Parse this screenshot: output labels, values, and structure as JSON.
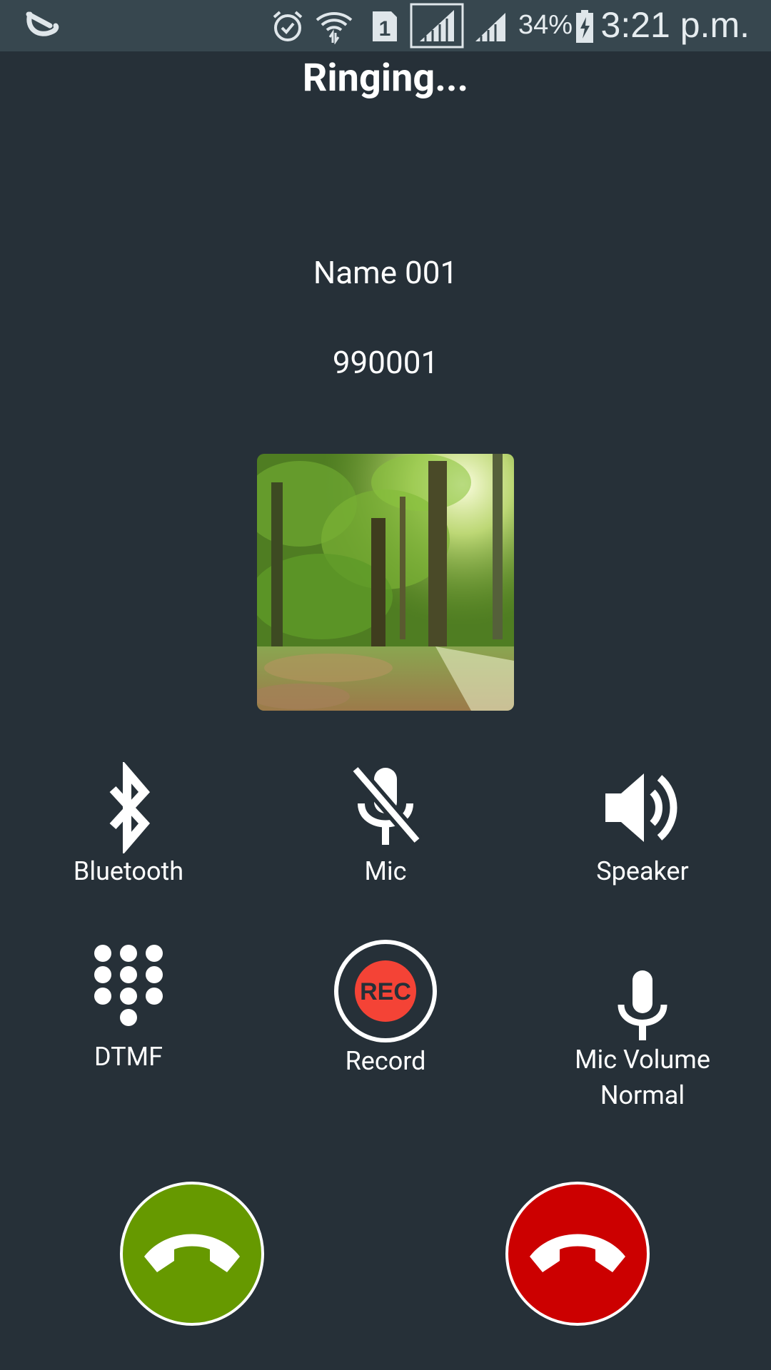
{
  "status_bar": {
    "app_icon": "app-logo-icon",
    "icons": [
      "alarm-icon",
      "wifi-icon",
      "sim-1-icon",
      "signal-sim1-icon",
      "signal-sim2-icon",
      "battery-charging-icon"
    ],
    "battery_percent": "34%",
    "time": "3:21 p.m."
  },
  "call": {
    "state": "Ringing...",
    "name": "Name 001",
    "number": "990001"
  },
  "controls": [
    {
      "label": "Bluetooth",
      "icon": "bluetooth-icon"
    },
    {
      "label": "Mic",
      "icon": "mic-off-icon"
    },
    {
      "label": "Speaker",
      "icon": "speaker-icon"
    },
    {
      "label": "DTMF",
      "icon": "dialpad-icon"
    },
    {
      "label": "Record",
      "icon": "record-icon",
      "badge": "REC"
    },
    {
      "label": "Mic Volume",
      "sublabel": "Normal",
      "icon": "mic-icon"
    }
  ],
  "actions": {
    "answer": {
      "icon": "phone-answer-icon",
      "color": "#669900"
    },
    "decline": {
      "icon": "phone-hangup-icon",
      "color": "#cc0000"
    }
  },
  "colors": {
    "background": "#263038",
    "status_bar": "#37474f",
    "record_red": "#f44336"
  }
}
